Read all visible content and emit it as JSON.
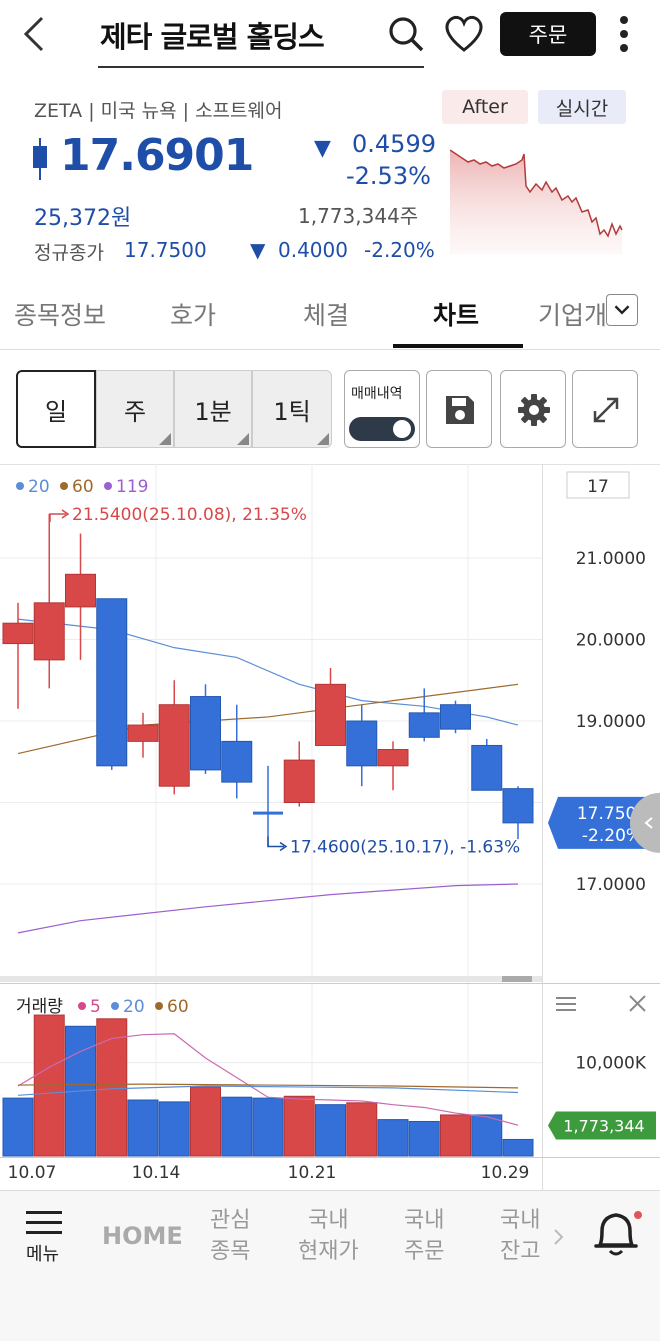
{
  "header": {
    "title": "제타 글로벌 홀딩스",
    "order_label": "주문"
  },
  "stock": {
    "meta": "ZETA | 미국 뉴욕 | 소프트웨어",
    "after_label": "After",
    "realtime_label": "실시간",
    "price": "17.6901",
    "change": "0.4599",
    "change_pct": "-2.53%",
    "krw": "25,372원",
    "volume": "1,773,344주",
    "close_label": "정규종가",
    "close_price": "17.7500",
    "close_change": "0.4000",
    "close_pct": "-2.20%",
    "down_symbol": "▼"
  },
  "tabs": [
    {
      "label": "종목정보"
    },
    {
      "label": "호가"
    },
    {
      "label": "체결"
    },
    {
      "label": "차트"
    },
    {
      "label": "기업개"
    }
  ],
  "periods": [
    {
      "label": "일"
    },
    {
      "label": "주"
    },
    {
      "label": "1분"
    },
    {
      "label": "1틱"
    }
  ],
  "toolbar": {
    "trade_history_label": "매매내역",
    "save_icon": "save-icon",
    "settings_icon": "gear-icon",
    "expand_icon": "expand-icon"
  },
  "chart_data": [
    {
      "type": "candlestick",
      "ma_legend": [
        {
          "label": "20",
          "color": "#5b8ed6"
        },
        {
          "label": "60",
          "color": "#a0692c"
        },
        {
          "label": "119",
          "color": "#9c5fd0"
        }
      ],
      "period_box": "17",
      "y_ticks": [
        "21.0000",
        "20.0000",
        "19.0000",
        "17.0000"
      ],
      "ylim": [
        16.6,
        22.3
      ],
      "x_labels": [
        "10.07",
        "10.14",
        "10.21",
        "10.29"
      ],
      "high_annotation": "21.5400(25.10.08), 21.35%",
      "low_annotation": "17.4600(25.10.17), -1.63%",
      "current_label": "17.7500",
      "current_pct": "-2.20%",
      "candles": [
        {
          "o": 19.95,
          "c": 20.2,
          "h": 20.45,
          "l": 19.15
        },
        {
          "o": 19.75,
          "c": 20.45,
          "h": 21.54,
          "l": 19.4
        },
        {
          "o": 20.4,
          "c": 20.8,
          "h": 21.3,
          "l": 19.75
        },
        {
          "o": 20.5,
          "c": 18.45,
          "h": 20.5,
          "l": 18.4
        },
        {
          "o": 18.75,
          "c": 18.95,
          "h": 19.1,
          "l": 18.55
        },
        {
          "o": 18.2,
          "c": 19.2,
          "h": 19.5,
          "l": 18.1
        },
        {
          "o": 19.3,
          "c": 18.4,
          "h": 19.45,
          "l": 18.35
        },
        {
          "o": 18.75,
          "c": 18.25,
          "h": 19.2,
          "l": 18.05
        },
        {
          "o": 17.87,
          "c": 17.87,
          "h": 18.45,
          "l": 17.46
        },
        {
          "o": 18.0,
          "c": 18.52,
          "h": 18.75,
          "l": 17.95
        },
        {
          "o": 18.7,
          "c": 19.45,
          "h": 19.65,
          "l": 18.7
        },
        {
          "o": 19.0,
          "c": 18.45,
          "h": 19.2,
          "l": 18.2
        },
        {
          "o": 18.45,
          "c": 18.65,
          "h": 18.75,
          "l": 18.15
        },
        {
          "o": 19.1,
          "c": 18.8,
          "h": 19.4,
          "l": 18.75
        },
        {
          "o": 19.2,
          "c": 18.9,
          "h": 19.25,
          "l": 18.85
        },
        {
          "o": 18.7,
          "c": 18.15,
          "h": 18.78,
          "l": 18.15
        },
        {
          "o": 18.17,
          "c": 17.75,
          "h": 18.2,
          "l": 17.55
        }
      ],
      "ma20": [
        [
          0,
          20.25
        ],
        [
          3,
          20.12
        ],
        [
          5,
          19.9
        ],
        [
          7,
          19.78
        ],
        [
          9,
          19.45
        ],
        [
          11,
          19.25
        ],
        [
          13,
          19.18
        ],
        [
          15,
          19.05
        ],
        [
          16,
          18.95
        ]
      ],
      "ma60": [
        [
          0,
          18.6
        ],
        [
          4,
          18.95
        ],
        [
          8,
          19.05
        ],
        [
          12,
          19.25
        ],
        [
          16,
          19.45
        ]
      ],
      "ma119": [
        [
          0,
          16.4
        ],
        [
          2,
          16.55
        ],
        [
          6,
          16.72
        ],
        [
          10,
          16.87
        ],
        [
          14,
          16.98
        ],
        [
          16,
          17.0
        ]
      ]
    },
    {
      "type": "bar",
      "title": "거래량",
      "ma_legend": [
        {
          "label": "5",
          "color": "#d44a8a"
        },
        {
          "label": "20",
          "color": "#5b8ed6"
        },
        {
          "label": "60",
          "color": "#a0692c"
        }
      ],
      "y_ticks": [
        "10,000K"
      ],
      "current_volume": "1,773,344",
      "ymax": 15000000,
      "values": [
        6200000,
        15100000,
        13900000,
        14700000,
        6000000,
        5800000,
        7400000,
        6300000,
        6200000,
        6400000,
        5500000,
        5700000,
        3900000,
        3700000,
        4400000,
        4400000,
        1773344
      ],
      "colors": [
        "blue",
        "red",
        "blue",
        "red",
        "blue",
        "blue",
        "red",
        "blue",
        "blue",
        "red",
        "blue",
        "red",
        "blue",
        "blue",
        "red",
        "blue",
        "blue"
      ]
    }
  ],
  "bottom_nav": {
    "menu": "메뉴",
    "home": "HOME",
    "watch_1": "관심",
    "watch_2": "종목",
    "domestic_price_1": "국내",
    "domestic_price_2": "현재가",
    "domestic_order_1": "국내",
    "domestic_order_2": "주문",
    "domestic_bal_1": "국내",
    "domestic_bal_2": "잔고"
  },
  "colors": {
    "up": "#d94848",
    "down": "#3470d8",
    "accent": "#1f4ea8"
  }
}
